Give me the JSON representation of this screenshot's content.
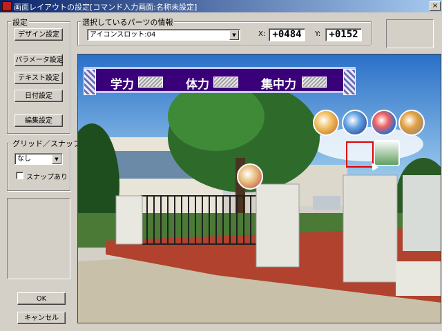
{
  "titlebar": {
    "title": "画面レイアウトの設定[コマンド入力画面:名称未設定]",
    "close_label": "×"
  },
  "settings": {
    "group_label": "設定",
    "design_button": "デザイン設定",
    "param_button": "パラメータ設定",
    "text_button": "テキスト設定",
    "date_button": "日付設定",
    "edit_button": "編集設定"
  },
  "grid": {
    "group_label": "グリッド／スナップ",
    "select_value": "なし",
    "snap_label": "スナップあり",
    "snap_checked": false
  },
  "footer": {
    "ok_label": "OK",
    "cancel_label": "キャンセル"
  },
  "selection": {
    "group_label": "選択しているパーツの情報",
    "part_value": "アイコンスロット:04",
    "x_label": "X:",
    "x_value": "+0484",
    "y_label": "Y:",
    "y_value": "+0152"
  },
  "preview": {
    "stats": [
      {
        "label": "学力"
      },
      {
        "label": "体力"
      },
      {
        "label": "集中力"
      }
    ],
    "icons": [
      "book-icon",
      "telescope-icon",
      "palette-icon",
      "toolbox-icon",
      "calendar-board-icon",
      "house-icon"
    ],
    "colors": {
      "status_bar_bg": "#3a007a",
      "selection_box": "#e00000",
      "sky": "#5aa0e0"
    }
  }
}
